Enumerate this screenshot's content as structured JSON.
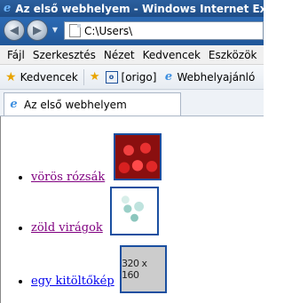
{
  "window": {
    "title": "Az első webhelyem - Windows Internet Explorer"
  },
  "address_bar": {
    "url": "C:\\Users\\"
  },
  "menu": [
    "Fájl",
    "Szerkesztés",
    "Nézet",
    "Kedvencek",
    "Eszközök"
  ],
  "favorites_bar": {
    "favorites_label": "Kedvencek",
    "items": [
      "[origo]",
      "Webhelyajánló"
    ]
  },
  "tab": {
    "title": "Az első webhelyem"
  },
  "page": {
    "links": [
      {
        "text": "vörös rózsák",
        "visited": true
      },
      {
        "text": "zöld virágok",
        "visited": true
      },
      {
        "text": "egy kitöltőkép",
        "visited": false
      }
    ],
    "placeholder_image_text": "320 x 160"
  },
  "colors": {
    "titlebar": "#1f4d86",
    "visited_link": "#800080",
    "link": "#0000ee",
    "image_border": "#1a4fa0"
  }
}
